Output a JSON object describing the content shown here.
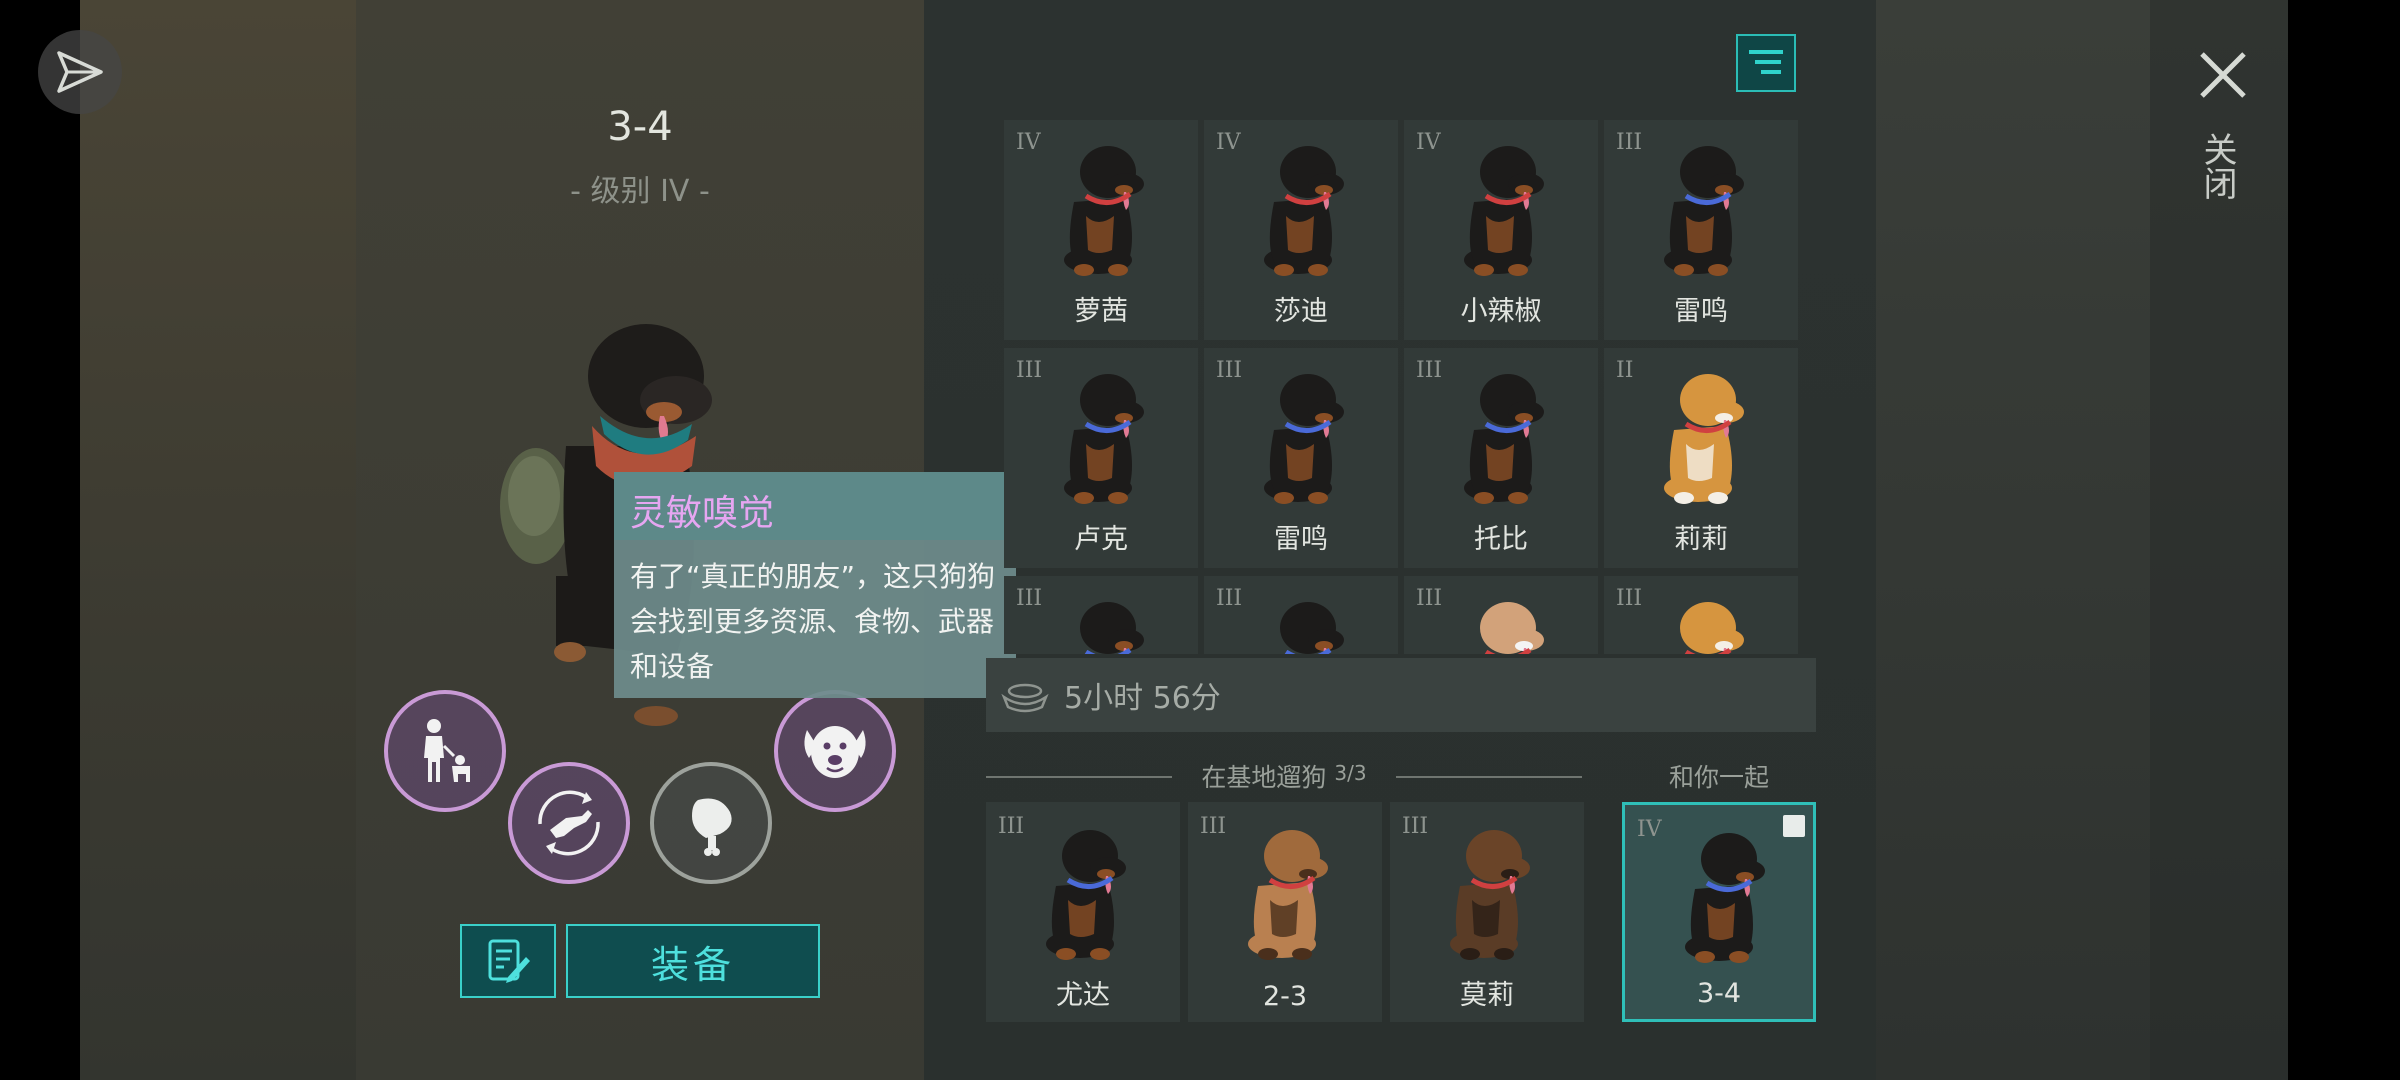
{
  "dog": {
    "title": "3-4",
    "level": "- 级别 IV -"
  },
  "tooltip": {
    "title": "灵敏嗅觉",
    "body": "有了“真正的朋友”，这只狗狗会找到更多资源、食物、武器和设备"
  },
  "actions": {
    "equip_label": "装备"
  },
  "grid_dogs": [
    {
      "rank": "IV",
      "name": "萝茜",
      "breed": "rottweiler",
      "collar": "#d04040"
    },
    {
      "rank": "IV",
      "name": "莎迪",
      "breed": "rottweiler",
      "collar": "#d04040"
    },
    {
      "rank": "IV",
      "name": "小辣椒",
      "breed": "rottweiler",
      "collar": "#d04040"
    },
    {
      "rank": "III",
      "name": "雷鸣",
      "breed": "rottweiler",
      "collar": "#4a6ad8"
    },
    {
      "rank": "III",
      "name": "卢克",
      "breed": "rottweiler",
      "collar": "#4a6ad8"
    },
    {
      "rank": "III",
      "name": "雷鸣",
      "breed": "rottweiler",
      "collar": "#4a6ad8"
    },
    {
      "rank": "III",
      "name": "托比",
      "breed": "rottweiler",
      "collar": "#4a6ad8"
    },
    {
      "rank": "II",
      "name": "莉莉",
      "breed": "corgi",
      "collar": "#d04040"
    },
    {
      "rank": "III",
      "name": "",
      "breed": "rottweiler",
      "collar": "#4a6ad8"
    },
    {
      "rank": "III",
      "name": "",
      "breed": "rottweiler",
      "collar": "#4a6ad8"
    },
    {
      "rank": "III",
      "name": "",
      "breed": "husky",
      "collar": "#d04040"
    },
    {
      "rank": "III",
      "name": "",
      "breed": "corgi",
      "collar": "#d04040"
    }
  ],
  "timer": {
    "text": "5小时 56分"
  },
  "walk_section": {
    "label": "在基地遛狗",
    "count": "3/3",
    "dogs": [
      {
        "rank": "III",
        "name": "尤达",
        "breed": "rottweiler",
        "collar": "#4a6ad8"
      },
      {
        "rank": "III",
        "name": "2-3",
        "breed": "shepherd",
        "collar": "#d04040"
      },
      {
        "rank": "III",
        "name": "莫莉",
        "breed": "shepherd_dark",
        "collar": "#d04040"
      }
    ]
  },
  "with_you": {
    "label": "和你一起",
    "dog": {
      "rank": "IV",
      "name": "3-4",
      "breed": "rottweiler",
      "collar": "#4a6ad8"
    }
  },
  "close": {
    "label": "关闭"
  },
  "colors": {
    "accent": "#2fbfb8",
    "tooltip_title": "#e6a6f2",
    "purple_ring": "#c99ad6"
  }
}
